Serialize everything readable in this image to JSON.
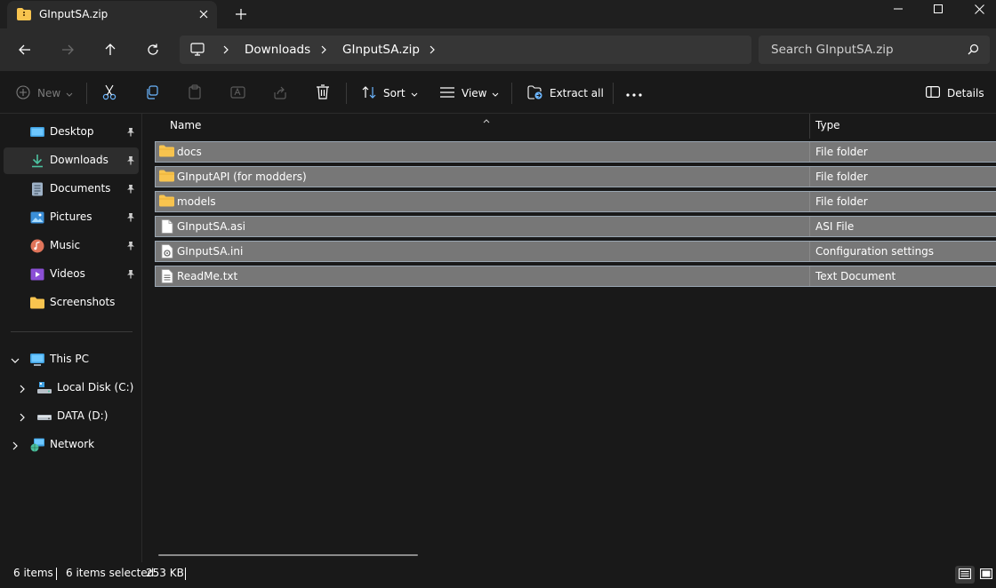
{
  "tab": {
    "title": "GInputSA.zip",
    "icon": "zip-folder-icon"
  },
  "window_controls": [
    "minimize-icon",
    "maximize-icon",
    "close-icon"
  ],
  "breadcrumbs": [
    "Downloads",
    "GInputSA.zip"
  ],
  "search": {
    "placeholder": "Search GInputSA.zip"
  },
  "commandbar": {
    "new_label": "New",
    "sort_label": "Sort",
    "view_label": "View",
    "extract_label": "Extract all",
    "details_label": "Details"
  },
  "sidebar": {
    "quick_access": [
      {
        "label": "Desktop",
        "icon": "desktop-icon",
        "pinned": true
      },
      {
        "label": "Downloads",
        "icon": "download-icon",
        "pinned": true,
        "active": true
      },
      {
        "label": "Documents",
        "icon": "documents-icon",
        "pinned": true
      },
      {
        "label": "Pictures",
        "icon": "pictures-icon",
        "pinned": true
      },
      {
        "label": "Music",
        "icon": "music-icon",
        "pinned": true
      },
      {
        "label": "Videos",
        "icon": "videos-icon",
        "pinned": true
      },
      {
        "label": "Screenshots",
        "icon": "folder-icon",
        "pinned": false
      }
    ],
    "this_pc": {
      "label": "This PC"
    },
    "drives": [
      {
        "label": "Local Disk (C:)"
      },
      {
        "label": "DATA (D:)"
      }
    ],
    "network": {
      "label": "Network"
    }
  },
  "columns": {
    "name": "Name",
    "type": "Type"
  },
  "files": [
    {
      "name": "docs",
      "type": "File folder",
      "icon": "folder-icon"
    },
    {
      "name": "GInputAPI (for modders)",
      "type": "File folder",
      "icon": "folder-icon"
    },
    {
      "name": "models",
      "type": "File folder",
      "icon": "folder-icon"
    },
    {
      "name": "GInputSA.asi",
      "type": "ASI File",
      "icon": "file-icon"
    },
    {
      "name": "GInputSA.ini",
      "type": "Configuration settings",
      "icon": "settings-file-icon"
    },
    {
      "name": "ReadMe.txt",
      "type": "Text Document",
      "icon": "text-file-icon"
    }
  ],
  "status": {
    "item_count": "6 items",
    "selected": "6 items selected",
    "size": "253 KB"
  },
  "colors": {
    "accent": "#60cdff",
    "folder": "#f8c44f",
    "selection": "#777777"
  }
}
